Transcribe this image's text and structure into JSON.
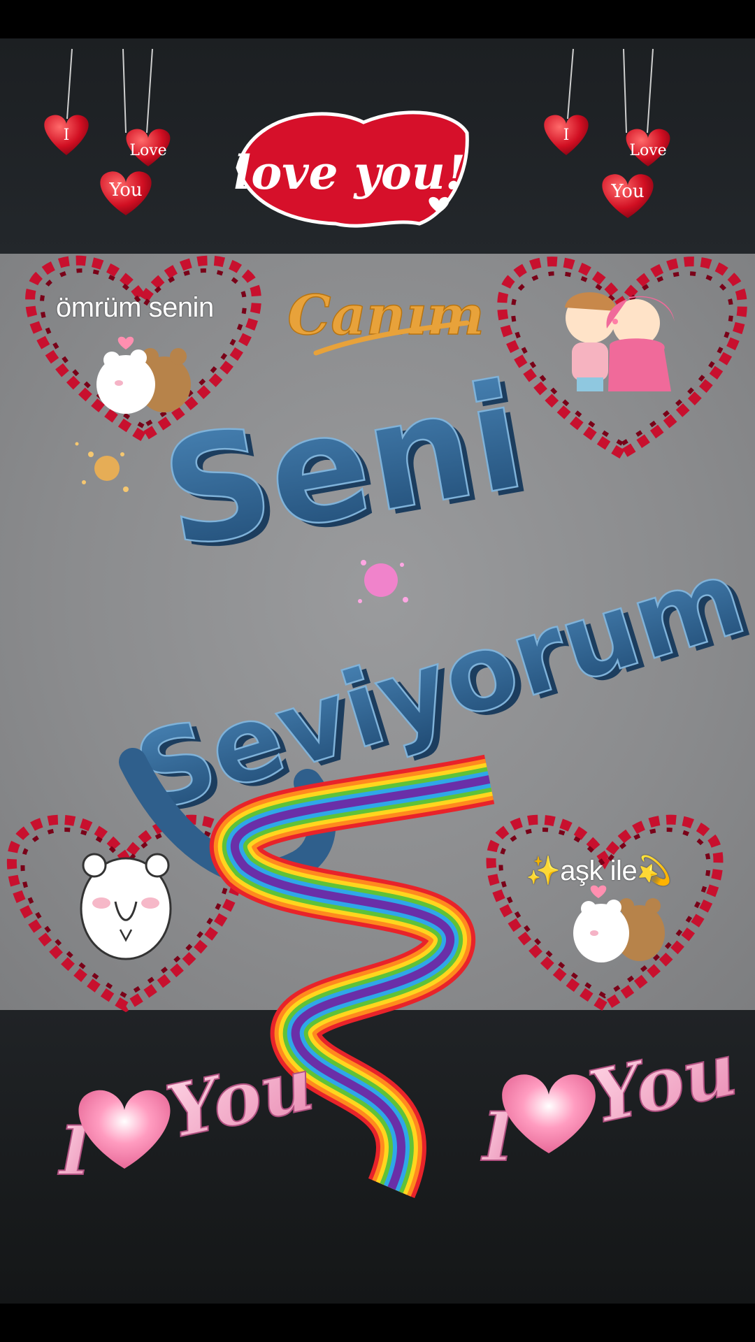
{
  "header": {
    "love_you_script": "love you!",
    "hanging_heart_words": [
      "I",
      "Love",
      "You"
    ]
  },
  "main": {
    "canim_script": "Canım",
    "title_line_1": "Seni",
    "title_line_2": "Seviyorum"
  },
  "captions": {
    "omrum_senin": "ömrüm senin",
    "ask_ile": "✨aşk ile💫"
  },
  "footer": {
    "i_love_you_sticker_left": [
      "I",
      "You"
    ],
    "i_love_you_sticker_right": [
      "I",
      "You"
    ]
  },
  "colors": {
    "background": "#1c1f22",
    "panel": "#8a8b8d",
    "title_blue": "#2f5f8c",
    "heart_red": "#e0102a",
    "canim_orange": "#e8a23a",
    "pink": "#f2a0c0"
  }
}
